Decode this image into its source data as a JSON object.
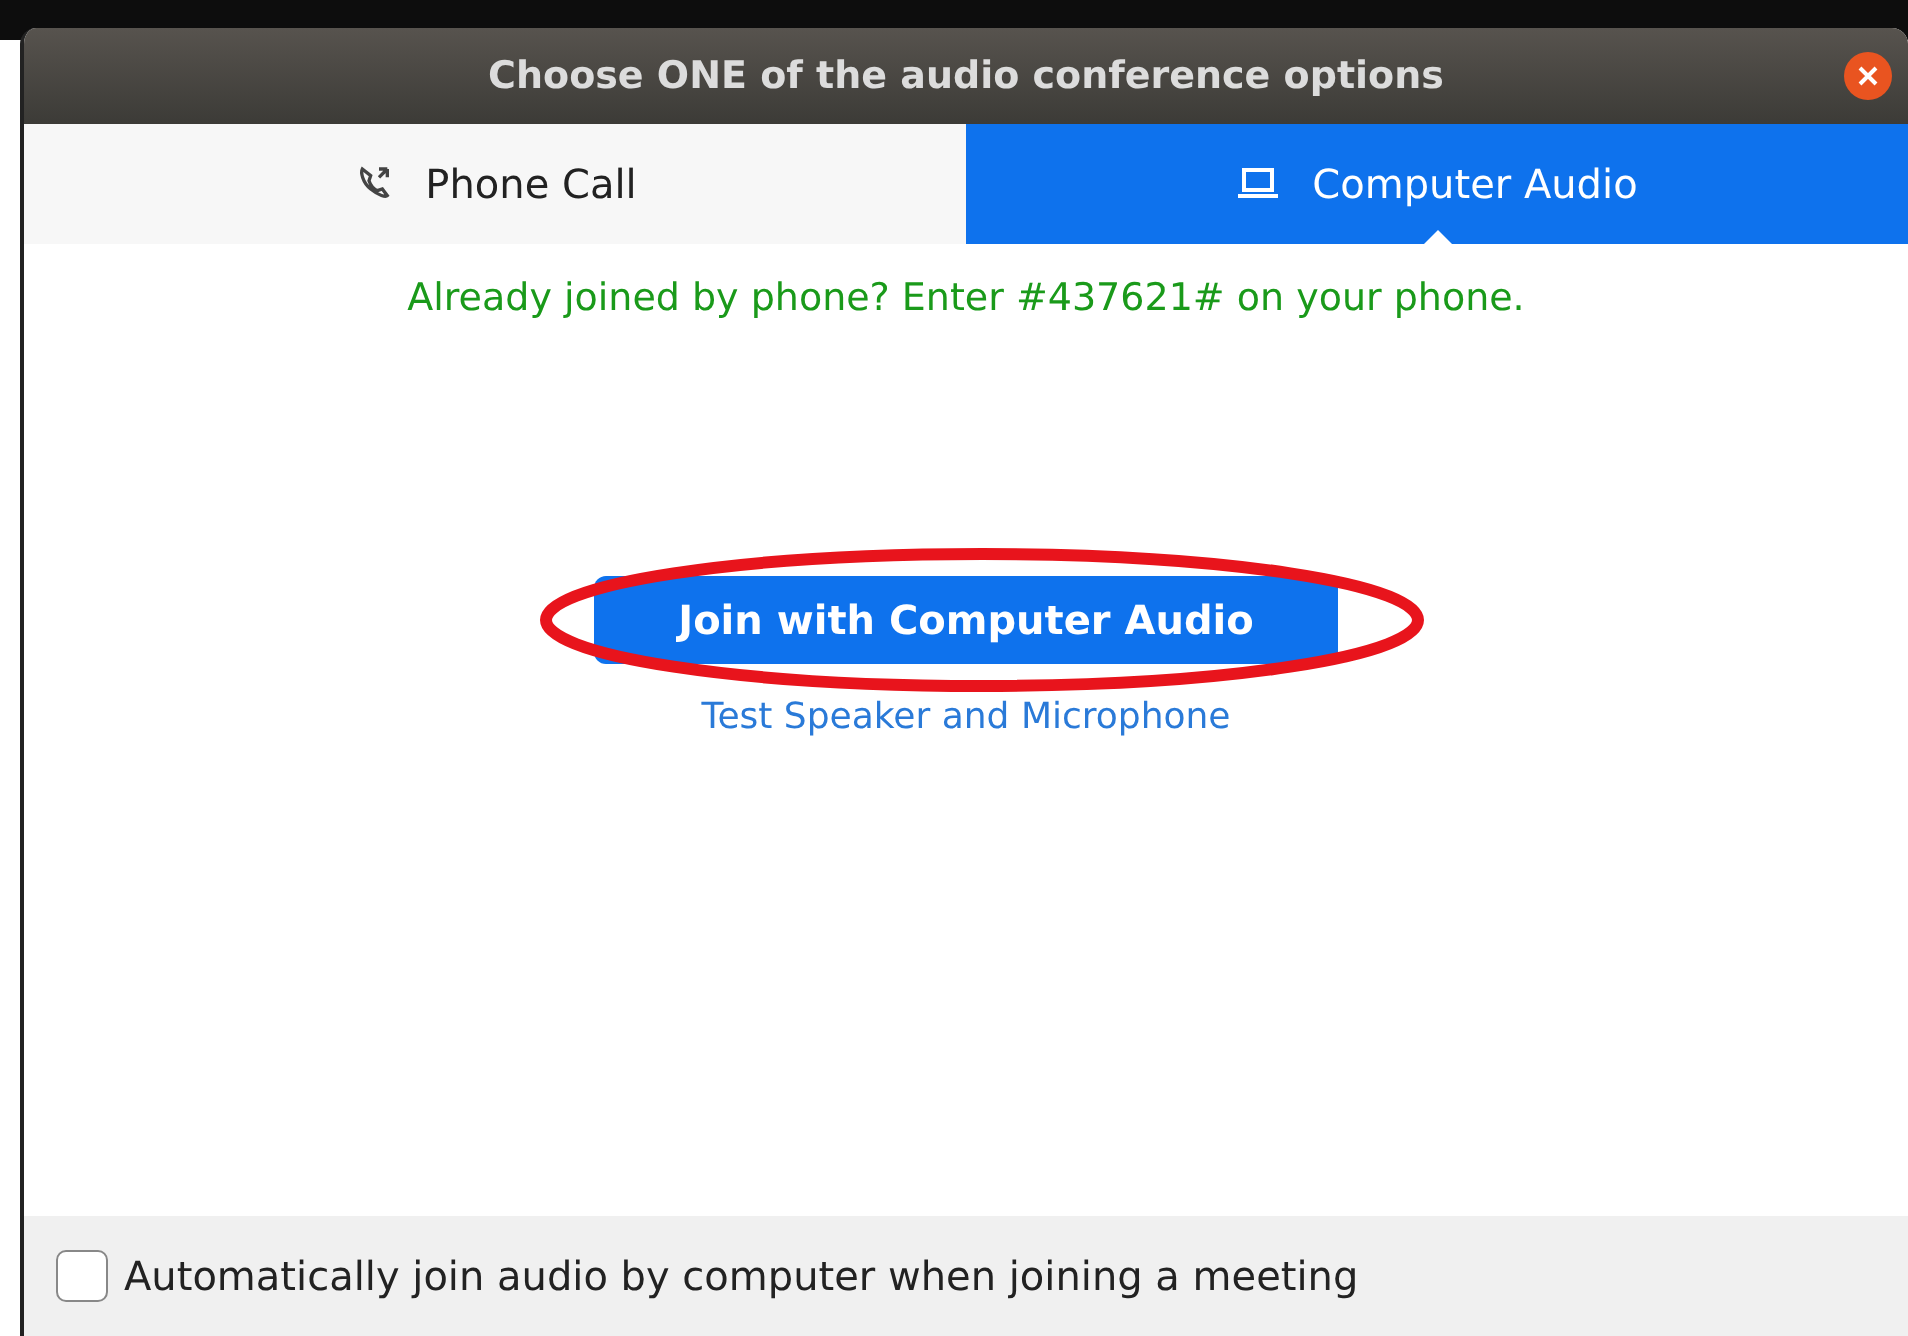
{
  "window": {
    "title": "Choose ONE of the audio conference options"
  },
  "tabs": [
    {
      "label": "Phone Call",
      "kind": "phone",
      "selected": false
    },
    {
      "label": "Computer Audio",
      "kind": "computer",
      "selected": true
    }
  ],
  "notice": "Already joined by phone? Enter #437621# on your phone.",
  "join_button": {
    "label": "Join with Computer Audio",
    "highlighted": true
  },
  "test_link": "Test Speaker and Microphone",
  "auto_join": {
    "label": "Automatically join audio by computer when joining a meeting",
    "checked": false
  }
}
